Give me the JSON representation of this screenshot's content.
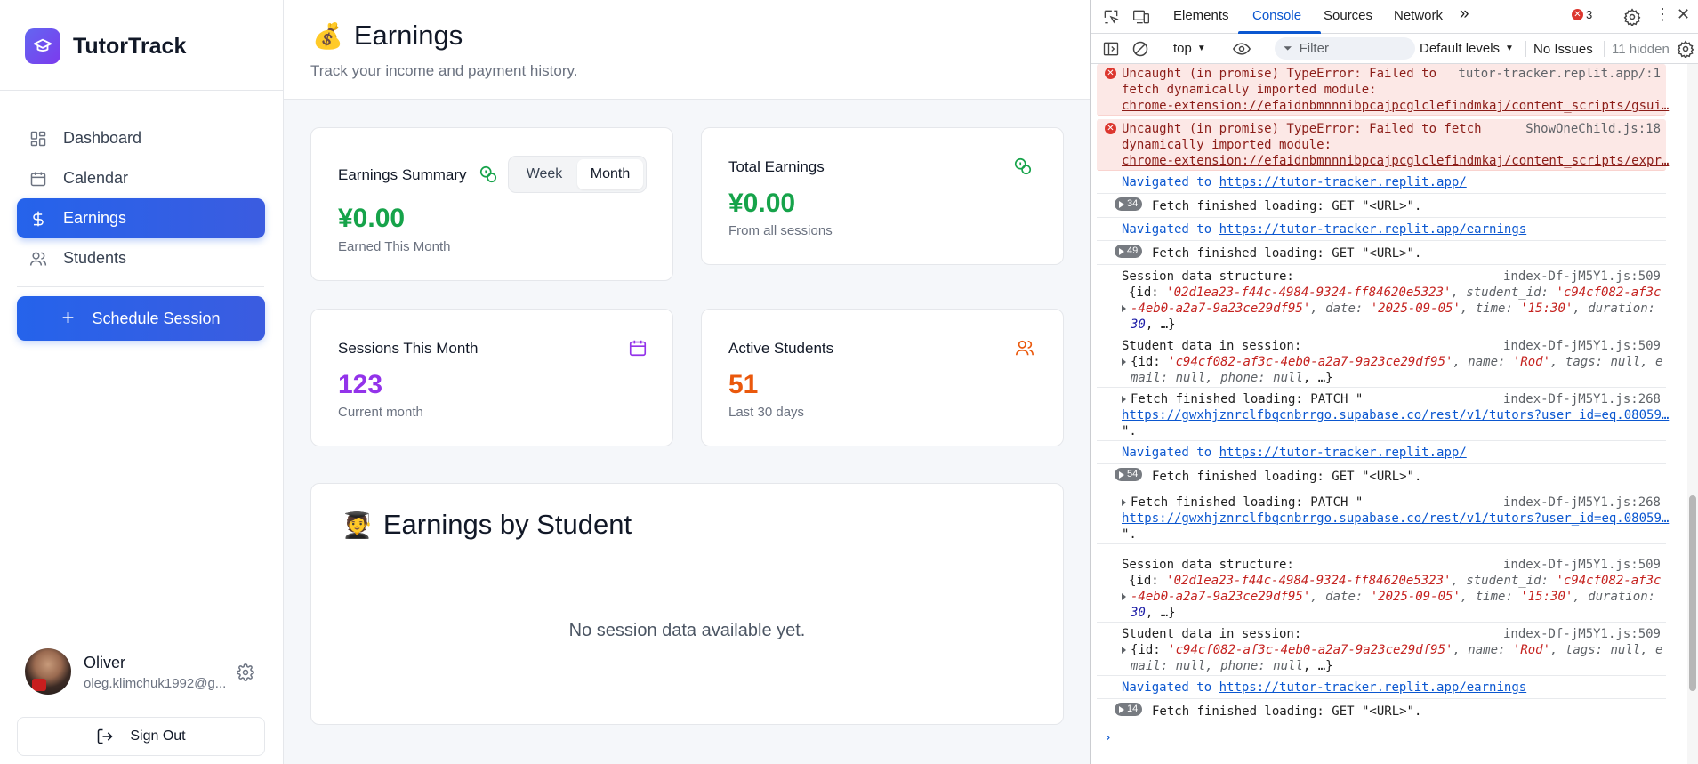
{
  "app": {
    "brand": "TutorTrack",
    "nav": [
      {
        "label": "Dashboard",
        "icon": "dashboard-icon"
      },
      {
        "label": "Calendar",
        "icon": "calendar-icon"
      },
      {
        "label": "Earnings",
        "icon": "dollar-icon",
        "active": true
      },
      {
        "label": "Students",
        "icon": "users-icon"
      }
    ],
    "schedule_button": "Schedule Session",
    "user": {
      "name": "Oliver",
      "email": "oleg.klimchuk1992@g..."
    },
    "sign_out": "Sign Out"
  },
  "page": {
    "emoji": "💰",
    "title": "Earnings",
    "subtitle": "Track your income and payment history."
  },
  "cards": {
    "summary": {
      "title": "Earnings Summary",
      "toggle": [
        "Week",
        "Month"
      ],
      "selected": "Month",
      "value": "¥0.00",
      "sub": "Earned This Month"
    },
    "total": {
      "title": "Total Earnings",
      "value": "¥0.00",
      "sub": "From all sessions"
    },
    "sessions": {
      "title": "Sessions This Month",
      "value": "123",
      "sub": "Current month"
    },
    "students": {
      "title": "Active Students",
      "value": "51",
      "sub": "Last 30 days"
    }
  },
  "by_student": {
    "emoji": "🧑‍🎓",
    "title": "Earnings by Student",
    "empty": "No session data available yet."
  },
  "colors": {
    "primary": "#2563eb",
    "green": "#16a34a",
    "purple": "#9333ea",
    "orange": "#ea580c"
  },
  "devtools": {
    "tabs": [
      "Elements",
      "Console",
      "Sources",
      "Network"
    ],
    "selected_tab": "Console",
    "more": "»",
    "error_count": "3",
    "context": "top",
    "filter_placeholder": "Filter",
    "levels": "Default levels",
    "issues": "No Issues",
    "hidden": "11 hidden",
    "log": {
      "e1_l1": "Uncaught (in promise) TypeError: Failed to",
      "e1_l2": "fetch dynamically imported module:",
      "e1_link": "chrome-extension://efaidnbmnnnibpcajpcglclefindmkaj/content_scripts/gsui…",
      "e1_src": "tutor-tracker.replit.app/:1",
      "e2_l1": "Uncaught (in promise) TypeError: Failed to fetch",
      "e2_l2": "dynamically imported module:",
      "e2_link": "chrome-extension://efaidnbmnnnibpcajpcglclefindmkaj/content_scripts/expr…",
      "e2_src": "ShowOneChild.js:18",
      "nav_text": "Navigated to",
      "nav_home": "https://tutor-tracker.replit.app/",
      "nav_earn": "https://tutor-tracker.replit.app/earnings",
      "fetch_get": "Fetch finished loading: GET \"<URL>\".",
      "count_34": "34",
      "count_49": "49",
      "count_54": "54",
      "count_14": "14",
      "src_509": "index-Df-jM5Y1.js:509",
      "src_268": "index-Df-jM5Y1.js:268",
      "sess_label": "Session data structure:",
      "sess_l1a": "{id: ",
      "sess_id": "'02d1ea23-f44c-4984-9324-ff84620e5323'",
      "sess_l1b": ", student_id: ",
      "sess_sid1": "'c94cf082-af3c",
      "sess_sid2": "-4eb0-a2a7-9a23ce29df95'",
      "sess_l2b": ", date: ",
      "sess_date": "'2025-09-05'",
      "sess_l2c": ", time: ",
      "sess_time": "'15:30'",
      "sess_l2d": ", duration:",
      "sess_dur": "30",
      "sess_end": ", …}",
      "stu_label": "Student data in session:",
      "stu_l1a": "{id: ",
      "stu_id": "'c94cf082-af3c-4eb0-a2a7-9a23ce29df95'",
      "stu_l1b": ", name: ",
      "stu_name": "'Rod'",
      "stu_l1c": ", tags: ",
      "stu_null": "null",
      "stu_l1d": ", e",
      "stu_l2a": "mail: ",
      "stu_l2b": ", phone: ",
      "stu_end": ", …}",
      "patch_l1": "Fetch finished loading: PATCH \"",
      "patch_link": "https://gwxhjznrclfbqcnbrrgo.supabase.co/rest/v1/tutors?user_id=eq.08059…",
      "patch_end": "\"."
    }
  }
}
